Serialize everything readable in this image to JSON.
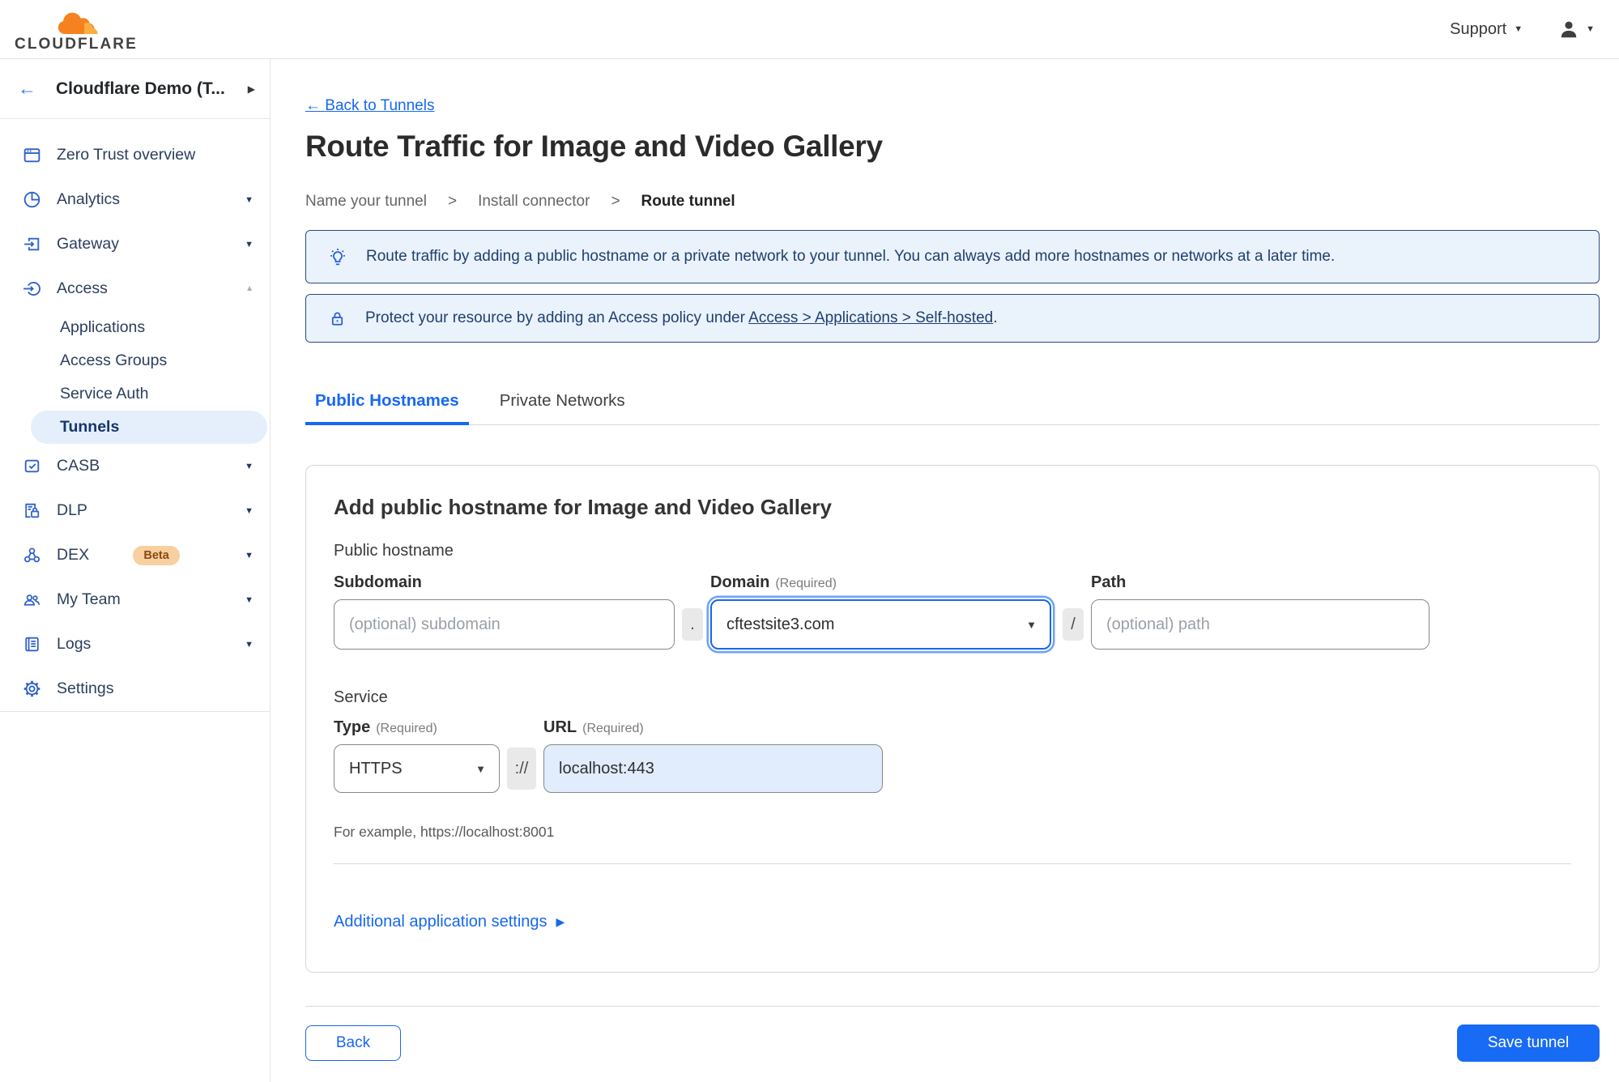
{
  "header": {
    "brand": "CLOUDFLARE",
    "support": "Support"
  },
  "icons": {
    "arrow_left": "←",
    "caret_down": "▼",
    "chevron_down": "▼",
    "chevron_up": "▲",
    "chevron_right": "▶"
  },
  "sidebar": {
    "account": "Cloudflare Demo (T...",
    "nav": {
      "zero_trust_overview": "Zero Trust overview",
      "analytics": "Analytics",
      "gateway": "Gateway",
      "access": "Access",
      "applications": "Applications",
      "access_groups": "Access Groups",
      "service_auth": "Service Auth",
      "tunnels": "Tunnels",
      "casb": "CASB",
      "dlp": "DLP",
      "dex": "DEX",
      "dex_badge": "Beta",
      "my_team": "My Team",
      "logs": "Logs",
      "settings": "Settings"
    }
  },
  "main": {
    "back_link": "Back to Tunnels",
    "title": "Route Traffic for Image and Video Gallery",
    "steps": {
      "step1": "Name your tunnel",
      "step2": "Install connector",
      "step3": "Route tunnel",
      "separator": ">"
    },
    "banners": {
      "tip": "Route traffic by adding a public hostname or a private network to your tunnel. You can always add more hostnames or networks at a later time.",
      "protect_prefix": "Protect your resource by adding an Access policy under ",
      "protect_link": "Access > Applications > Self-hosted",
      "protect_suffix": "."
    },
    "tabs": {
      "public_hostnames": "Public Hostnames",
      "private_networks": "Private Networks"
    },
    "form": {
      "heading": "Add public hostname for Image and Video Gallery",
      "public_hostname": "Public hostname",
      "subdomain_label": "Subdomain",
      "subdomain_placeholder": "(optional) subdomain",
      "dot": ".",
      "domain_label": "Domain",
      "required": "(Required)",
      "domain_value": "cftestsite3.com",
      "slash": "/",
      "path_label": "Path",
      "path_placeholder": "(optional) path",
      "service": "Service",
      "type_label": "Type",
      "type_value": "HTTPS",
      "scheme": "://",
      "url_label": "URL",
      "url_value": "localhost:443",
      "example": "For example, https://localhost:8001",
      "additional_settings": "Additional application settings"
    },
    "footer": {
      "back": "Back",
      "save": "Save tunnel"
    }
  },
  "colors": {
    "accent_blue": "#1767F2",
    "brand_orange": "#F6821F",
    "brand_orange_light": "#FBAD41",
    "banner_bg": "#EAF2FC",
    "banner_border": "#2C4C80",
    "banner_text": "#20406F",
    "active_pill_bg": "#E4EFFB",
    "autofill_bg": "#E1ECFC"
  }
}
